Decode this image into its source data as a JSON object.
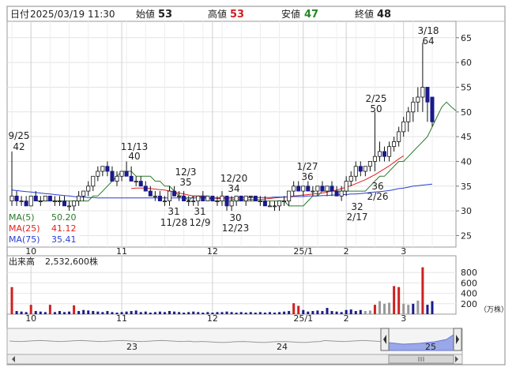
{
  "header": {
    "date_label": "日付",
    "date_value": "2025/03/19 11:30",
    "open_label": "始値",
    "open_value": "53",
    "high_label": "高値",
    "high_value": "53",
    "low_label": "安値",
    "low_value": "47",
    "close_label": "終値",
    "close_value": "48"
  },
  "legend": {
    "ma5_label": "MA(5)",
    "ma5_value": "50.20",
    "ma25_label": "MA(25)",
    "ma25_value": "41.12",
    "ma75_label": "MA(75)",
    "ma75_value": "35.41"
  },
  "volume_info": {
    "label": "出来高",
    "value": "2,532,600株"
  },
  "volume_unit": "（万株）",
  "colors": {
    "up": "#ffffff",
    "down": "#1a1a8c",
    "ma5": "#2a7a2a",
    "ma25": "#e02020",
    "ma75": "#2a3fd0",
    "vol_normal": "#1a1a8c",
    "vol_up": "#d02020",
    "vol_gray": "#999999",
    "high": "#cc2222",
    "low": "#228822",
    "navigator_fill": "#9aa7e8"
  },
  "chart_data": [
    {
      "type": "candlestick",
      "ylim": [
        23,
        68
      ],
      "yticks": [
        25,
        30,
        35,
        40,
        45,
        50,
        55,
        60,
        65
      ],
      "x_month_labels": [
        "10",
        "11",
        "12",
        "25/1",
        "2",
        "3"
      ],
      "annotations": [
        {
          "date": "9/25",
          "value": "42"
        },
        {
          "date": "11/13",
          "value": "40"
        },
        {
          "date": "12/3",
          "value": "35"
        },
        {
          "date": "11/28",
          "value": "31"
        },
        {
          "date": "12/9",
          "value": "31"
        },
        {
          "date": "12/20",
          "value": "34"
        },
        {
          "date": "12/23",
          "value": "30"
        },
        {
          "date": "1/27",
          "value": "36"
        },
        {
          "date": "2/17",
          "value": "32"
        },
        {
          "date": "2/25",
          "value": "50"
        },
        {
          "date": "2/26",
          "value": "36"
        },
        {
          "date": "3/18",
          "value": "64"
        }
      ],
      "ohlc": [
        [
          32,
          42,
          31,
          33
        ],
        [
          33,
          34,
          31,
          32
        ],
        [
          32,
          33,
          31,
          32
        ],
        [
          32,
          33,
          31,
          31
        ],
        [
          31,
          33,
          31,
          33
        ],
        [
          33,
          34,
          32,
          32
        ],
        [
          32,
          33,
          31,
          32
        ],
        [
          32,
          33,
          32,
          33
        ],
        [
          33,
          33,
          32,
          32
        ],
        [
          32,
          33,
          31,
          32
        ],
        [
          32,
          33,
          31,
          32
        ],
        [
          32,
          33,
          31,
          31
        ],
        [
          31,
          32,
          30,
          31
        ],
        [
          31,
          32,
          30,
          32
        ],
        [
          32,
          34,
          31,
          33
        ],
        [
          33,
          34,
          32,
          34
        ],
        [
          34,
          36,
          33,
          35
        ],
        [
          35,
          37,
          34,
          37
        ],
        [
          37,
          39,
          36,
          38
        ],
        [
          38,
          39,
          37,
          39
        ],
        [
          39,
          40,
          37,
          38
        ],
        [
          38,
          39,
          36,
          36
        ],
        [
          36,
          38,
          35,
          37
        ],
        [
          37,
          38,
          36,
          38
        ],
        [
          38,
          40,
          37,
          37
        ],
        [
          37,
          39,
          36,
          36
        ],
        [
          36,
          37,
          35,
          36
        ],
        [
          36,
          37,
          35,
          35
        ],
        [
          35,
          36,
          34,
          34
        ],
        [
          34,
          35,
          33,
          33
        ],
        [
          33,
          34,
          32,
          33
        ],
        [
          33,
          34,
          32,
          32
        ],
        [
          32,
          33,
          31,
          32
        ],
        [
          32,
          35,
          31,
          34
        ],
        [
          34,
          35,
          33,
          33
        ],
        [
          33,
          34,
          32,
          33
        ],
        [
          33,
          34,
          32,
          32
        ],
        [
          32,
          33,
          31,
          32
        ],
        [
          32,
          33,
          31,
          32
        ],
        [
          32,
          33,
          31,
          33
        ],
        [
          33,
          34,
          32,
          32
        ],
        [
          32,
          33,
          32,
          33
        ],
        [
          33,
          33,
          32,
          32
        ],
        [
          32,
          33,
          31,
          32
        ],
        [
          32,
          34,
          31,
          33
        ],
        [
          33,
          33,
          30,
          31
        ],
        [
          31,
          33,
          30,
          32
        ],
        [
          32,
          33,
          31,
          33
        ],
        [
          33,
          33,
          32,
          32
        ],
        [
          32,
          33,
          31,
          33
        ],
        [
          33,
          33,
          32,
          33
        ],
        [
          33,
          33,
          32,
          32
        ],
        [
          32,
          33,
          31,
          32
        ],
        [
          32,
          33,
          31,
          31
        ],
        [
          31,
          32,
          31,
          31
        ],
        [
          31,
          32,
          30,
          31
        ],
        [
          31,
          32,
          30,
          32
        ],
        [
          32,
          33,
          31,
          32
        ],
        [
          32,
          34,
          31,
          34
        ],
        [
          34,
          36,
          33,
          35
        ],
        [
          35,
          36,
          34,
          34
        ],
        [
          34,
          35,
          33,
          35
        ],
        [
          35,
          36,
          34,
          34
        ],
        [
          34,
          35,
          33,
          34
        ],
        [
          34,
          35,
          33,
          35
        ],
        [
          35,
          36,
          34,
          34
        ],
        [
          34,
          35,
          33,
          35
        ],
        [
          35,
          36,
          33,
          34
        ],
        [
          34,
          35,
          33,
          33
        ],
        [
          33,
          35,
          32,
          34
        ],
        [
          34,
          37,
          33,
          36
        ],
        [
          36,
          38,
          35,
          37
        ],
        [
          37,
          40,
          36,
          39
        ],
        [
          39,
          40,
          37,
          38
        ],
        [
          38,
          39,
          37,
          39
        ],
        [
          39,
          40,
          38,
          40
        ],
        [
          40,
          50,
          38,
          41
        ],
        [
          41,
          44,
          40,
          42
        ],
        [
          42,
          43,
          40,
          41
        ],
        [
          41,
          44,
          40,
          43
        ],
        [
          43,
          45,
          42,
          44
        ],
        [
          44,
          47,
          43,
          46
        ],
        [
          46,
          49,
          45,
          48
        ],
        [
          48,
          51,
          46,
          50
        ],
        [
          50,
          53,
          48,
          52
        ],
        [
          52,
          55,
          50,
          53
        ],
        [
          53,
          64,
          50,
          55
        ],
        [
          55,
          55,
          48,
          52
        ],
        [
          53,
          53,
          47,
          48
        ]
      ],
      "ma_series": [
        {
          "name": "MA(5)",
          "start": 5,
          "values": [
            32,
            32,
            32,
            32,
            32,
            32,
            32,
            32,
            32,
            32,
            32,
            32,
            33,
            33,
            34,
            35,
            36,
            37,
            38,
            38,
            38,
            37,
            37,
            37,
            37,
            36,
            36,
            35,
            35,
            34,
            33,
            33,
            32,
            33,
            33,
            33,
            33,
            32,
            32,
            32,
            32,
            32,
            32,
            32,
            32,
            32,
            32,
            32,
            32,
            32,
            32,
            32,
            32,
            31,
            31,
            31,
            31,
            32,
            33,
            33,
            34,
            34,
            34,
            34,
            34,
            34,
            34,
            34,
            34,
            34,
            35,
            36,
            37,
            37,
            38,
            39,
            40,
            40,
            41,
            42,
            43,
            44,
            45,
            47,
            49,
            51,
            52,
            51,
            50.2
          ]
        },
        {
          "name": "MA(25)",
          "start": 25,
          "values": [
            34.5,
            34.6,
            34.6,
            34.6,
            34.5,
            34.4,
            34.3,
            34.2,
            34.0,
            33.8,
            33.6,
            33.4,
            33.2,
            33.0,
            32.9,
            32.8,
            32.7,
            32.6,
            32.5,
            32.5,
            32.4,
            32.4,
            32.3,
            32.3,
            32.3,
            32.3,
            32.3,
            32.3,
            32.4,
            32.5,
            32.6,
            32.7,
            32.8,
            32.9,
            33.0,
            33.1,
            33.2,
            33.3,
            33.4,
            33.5,
            33.6,
            33.8,
            34.0,
            34.2,
            34.5,
            34.8,
            35.1,
            35.5,
            35.9,
            36.3,
            36.8,
            37.3,
            37.9,
            38.5,
            39.1,
            39.8,
            40.5,
            41.12
          ]
        },
        {
          "name": "MA(75)",
          "start": 0,
          "values": [
            34.2,
            34.1,
            34.0,
            33.9,
            33.8,
            33.7,
            33.6,
            33.5,
            33.4,
            33.3,
            33.2,
            33.1,
            33.0,
            32.9,
            32.8,
            32.8,
            32.7,
            32.7,
            32.6,
            32.6,
            32.6,
            32.6,
            32.6,
            32.6,
            32.6,
            32.6,
            32.6,
            32.6,
            32.6,
            32.6,
            32.6,
            32.6,
            32.6,
            32.6,
            32.6,
            32.6,
            32.6,
            32.6,
            32.6,
            32.6,
            32.6,
            32.6,
            32.6,
            32.6,
            32.7,
            32.7,
            32.7,
            32.7,
            32.7,
            32.7,
            32.7,
            32.7,
            32.7,
            32.7,
            32.7,
            32.8,
            32.8,
            32.8,
            32.8,
            32.9,
            32.9,
            32.9,
            33.0,
            33.0,
            33.0,
            33.1,
            33.1,
            33.2,
            33.2,
            33.3,
            33.3,
            33.4,
            33.4,
            33.5,
            33.6,
            33.7,
            33.8,
            33.9,
            34.0,
            34.1,
            34.3,
            34.5,
            34.6,
            34.8,
            35.0,
            35.1,
            35.2,
            35.3,
            35.41
          ]
        }
      ]
    },
    {
      "type": "bar",
      "name": "volume",
      "ylim": [
        0,
        1000
      ],
      "yticks": [
        200,
        400,
        600,
        800
      ],
      "values": [
        520,
        60,
        50,
        40,
        180,
        60,
        50,
        40,
        180,
        40,
        60,
        40,
        50,
        170,
        60,
        80,
        70,
        60,
        50,
        40,
        60,
        40,
        30,
        40,
        50,
        60,
        70,
        40,
        50,
        30,
        40,
        50,
        40,
        60,
        50,
        40,
        30,
        40,
        50,
        40,
        30,
        40,
        30,
        40,
        40,
        50,
        40,
        30,
        40,
        30,
        40,
        30,
        40,
        30,
        40,
        30,
        40,
        50,
        60,
        210,
        160,
        80,
        50,
        60,
        70,
        60,
        120,
        60,
        50,
        40,
        80,
        90,
        60,
        80,
        60,
        70,
        180,
        250,
        200,
        220,
        540,
        520,
        200,
        180,
        200,
        260,
        900,
        180,
        250
      ],
      "highlight_up": [
        0,
        4,
        8,
        13,
        59,
        60,
        76,
        80,
        81,
        86
      ],
      "gray": [
        74,
        75,
        77,
        78,
        79,
        82,
        83,
        85
      ]
    }
  ],
  "navigator": {
    "year_labels": [
      "23",
      "24",
      "25"
    ]
  }
}
